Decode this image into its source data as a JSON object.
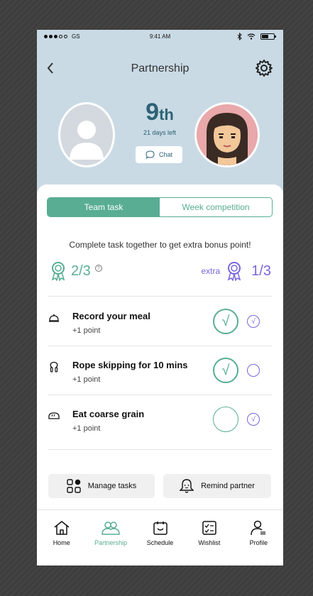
{
  "status_bar": {
    "carrier": "GS",
    "time": "9:41 AM"
  },
  "header": {
    "title": "Partnership"
  },
  "rank": {
    "number": "9",
    "suffix": "th",
    "days_left": "21 days left",
    "chat_label": "Chat"
  },
  "tabs": [
    {
      "label": "Team task",
      "active": true
    },
    {
      "label": "Week competition",
      "active": false
    }
  ],
  "tagline": "Complete task together to get extra bonus point!",
  "score": {
    "team": "2/3",
    "extra_label": "extra",
    "extra": "1/3"
  },
  "tasks": [
    {
      "title": "Record your meal",
      "points": "+1 point",
      "icon": "cloche-icon",
      "self_done": true,
      "partner_done": true
    },
    {
      "title": "Rope skipping for 10 mins",
      "points": "+1 point",
      "icon": "jump-rope-icon",
      "self_done": true,
      "partner_done": false
    },
    {
      "title": "Eat  coarse grain",
      "points": "+1 point",
      "icon": "bread-icon",
      "self_done": false,
      "partner_done": true
    }
  ],
  "actions": {
    "manage": "Manage tasks",
    "remind": "Remind  partner"
  },
  "bottom_nav": [
    {
      "label": "Home",
      "icon": "home-icon"
    },
    {
      "label": "Partnership",
      "icon": "partners-icon",
      "active": true
    },
    {
      "label": "Schedule",
      "icon": "calendar-icon"
    },
    {
      "label": "Wishlist",
      "icon": "checklist-icon"
    },
    {
      "label": "Profile",
      "icon": "profile-icon"
    }
  ],
  "colors": {
    "accent": "#58ad93",
    "purple": "#7b66dc",
    "hero_bg": "#c9dae5",
    "rank_text": "#2d6275"
  }
}
